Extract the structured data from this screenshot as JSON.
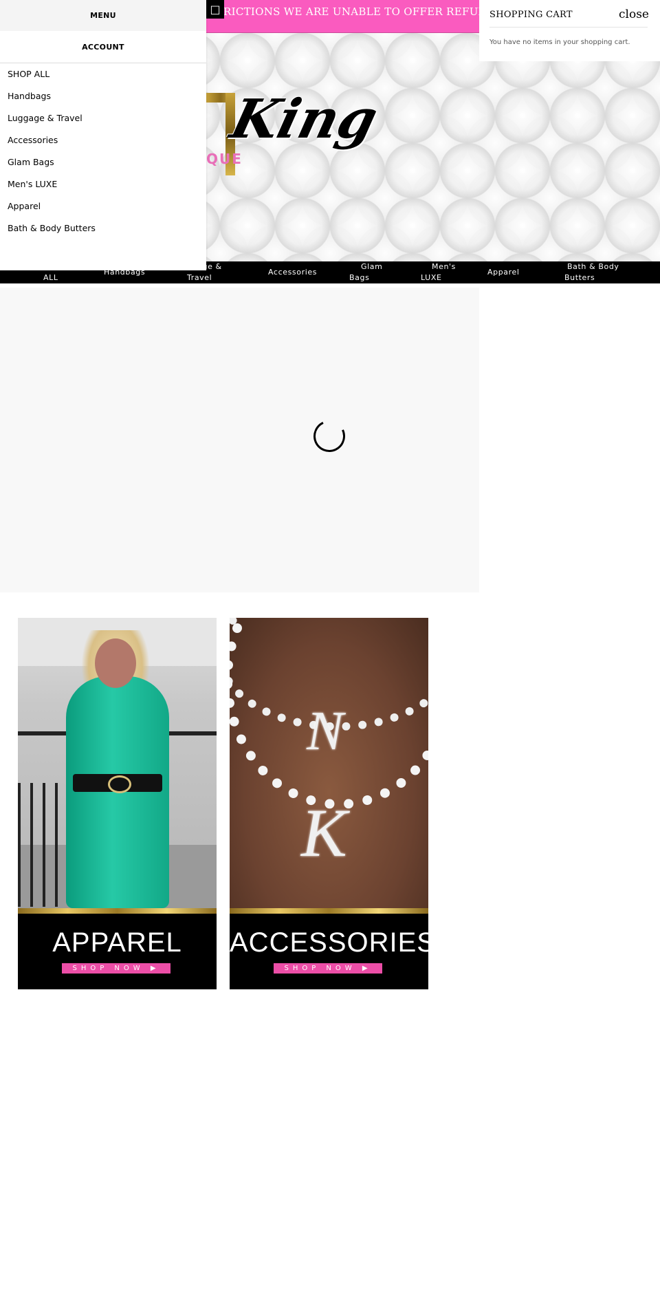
{
  "promo_banner": {
    "text": "RICTIONS WE ARE UNABLE TO OFFER REFUNDS OR EX",
    "close_icon": "close-icon"
  },
  "logo": {
    "script_text": "King",
    "sub_text": "QUE"
  },
  "category_nav": {
    "items": [
      {
        "line1": "",
        "line2": "ALL"
      },
      {
        "line1": "Handbags",
        "line2": ""
      },
      {
        "line1": "ggage &",
        "line2": "Travel"
      },
      {
        "line1": "Accessories",
        "line2": ""
      },
      {
        "line1": "Glam",
        "line2": "Bags"
      },
      {
        "line1": "Men's",
        "line2": "LUXE"
      },
      {
        "line1": "Apparel",
        "line2": ""
      },
      {
        "line1": "Bath & Body",
        "line2": "Butters"
      }
    ]
  },
  "menu_drawer": {
    "menu_tab": "MENU",
    "account_tab": "ACCOUNT",
    "items": [
      "SHOP ALL",
      "Handbags",
      "Luggage & Travel",
      "Accessories",
      "Glam Bags",
      "Men's LUXE",
      "Apparel",
      "Bath & Body Butters"
    ]
  },
  "cart_panel": {
    "title": "SHOPPING CART",
    "close_label": "close",
    "empty_message": "You have no items in your shopping cart."
  },
  "slider": {
    "spinner_icon": "loading-spinner-icon"
  },
  "tiles": [
    {
      "title": "APPAREL",
      "button": "SHOP NOW ▶"
    },
    {
      "title": "ACCESSORIES",
      "button": "SHOP NOW ▶"
    }
  ],
  "colors": {
    "accent_pink": "#fa5bbf",
    "button_pink": "#ec4ea7",
    "nav_black": "#000000",
    "gold": "#c7a23a"
  }
}
